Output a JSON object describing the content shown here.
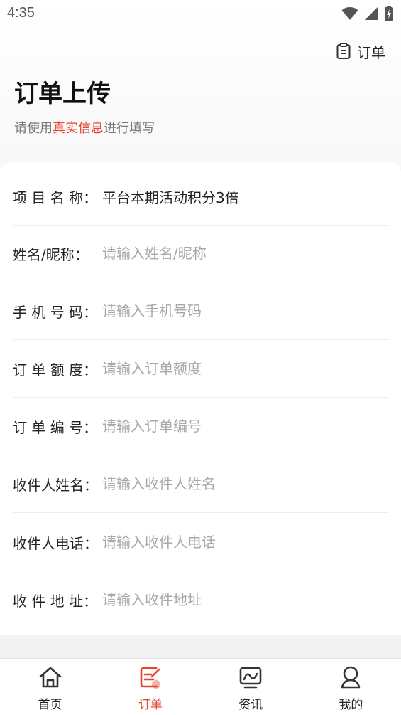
{
  "status_bar": {
    "time": "4:35"
  },
  "header": {
    "order_link_label": "订单"
  },
  "page": {
    "title": "订单上传",
    "subtitle_prefix": "请使用",
    "subtitle_highlight": "真实信息",
    "subtitle_suffix": "进行填写"
  },
  "form": {
    "rows": [
      {
        "label": "项 目 名 称：",
        "value": "平台本期活动积分3倍"
      },
      {
        "label": "姓名/昵称：",
        "placeholder": "请输入姓名/昵称",
        "value": ""
      },
      {
        "label": "手 机 号 码：",
        "placeholder": "请输入手机号码",
        "value": ""
      },
      {
        "label": "订 单 额 度：",
        "placeholder": "请输入订单额度",
        "value": ""
      },
      {
        "label": "订 单 编 号：",
        "placeholder": "请输入订单编号",
        "value": ""
      },
      {
        "label": "收件人姓名：",
        "placeholder": "请输入收件人姓名",
        "value": ""
      },
      {
        "label": "收件人电话：",
        "placeholder": "请输入收件人电话",
        "value": ""
      },
      {
        "label": "收 件 地 址：",
        "placeholder": "请输入收件地址",
        "value": ""
      }
    ]
  },
  "bottom_nav": {
    "items": [
      {
        "label": "首页",
        "icon": "home-icon"
      },
      {
        "label": "订单",
        "icon": "order-edit-icon",
        "active": true
      },
      {
        "label": "资讯",
        "icon": "news-icon"
      },
      {
        "label": "我的",
        "icon": "profile-icon"
      }
    ]
  },
  "colors": {
    "accent": "#e8432e",
    "placeholder": "#a8a8a8",
    "divider": "#eeeeee",
    "background": "#f5f5f5"
  }
}
